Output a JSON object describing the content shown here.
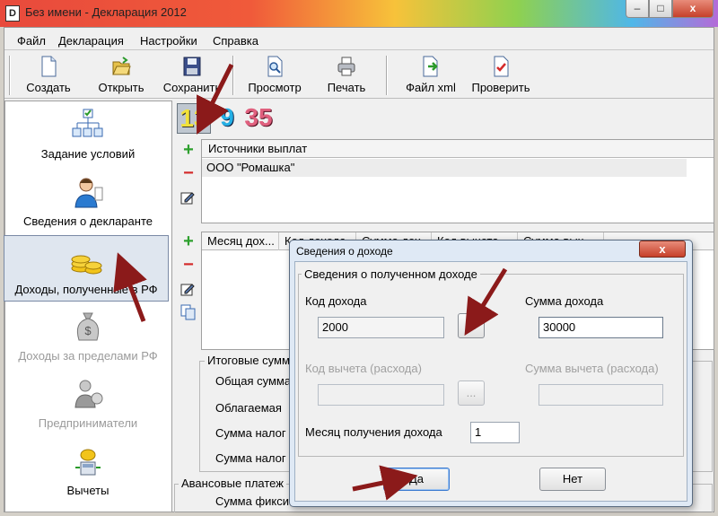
{
  "window": {
    "title": "Без имени - Декларация 2012",
    "app_icon": "document-icon"
  },
  "menu": [
    "Файл",
    "Декларация",
    "Настройки",
    "Справка"
  ],
  "toolbar": {
    "buttons": [
      {
        "label": "Создать",
        "icon": "new-document-icon"
      },
      {
        "label": "Открыть",
        "icon": "open-folder-icon"
      },
      {
        "label": "Сохранить",
        "icon": "floppy-save-icon"
      },
      {
        "label": "Просмотр",
        "icon": "preview-icon"
      },
      {
        "label": "Печать",
        "icon": "printer-icon"
      },
      {
        "label": "Файл xml",
        "icon": "xml-export-icon"
      },
      {
        "label": "Проверить",
        "icon": "check-document-icon"
      }
    ]
  },
  "sidebar": {
    "items": [
      {
        "label": "Задание условий",
        "icon": "conditions-tree-icon",
        "enabled": true
      },
      {
        "label": "Сведения о декларанте",
        "icon": "person-icon",
        "enabled": true
      },
      {
        "label": "Доходы, полученные в РФ",
        "icon": "coins-icon",
        "enabled": true,
        "selected": true
      },
      {
        "label": "Доходы за пределами РФ",
        "icon": "money-bag-icon",
        "enabled": false
      },
      {
        "label": "Предприниматели",
        "icon": "entrepreneur-icon",
        "enabled": false
      },
      {
        "label": "Вычеты",
        "icon": "deductions-icon",
        "enabled": true
      }
    ]
  },
  "rate_tabs": [
    "13",
    "9",
    "35"
  ],
  "sources": {
    "header": "Источники выплат",
    "rows": [
      "ООО \"Ромашка\""
    ]
  },
  "income_grid": {
    "columns": [
      "Месяц дох...",
      "Код дохода",
      "Сумма дох...",
      "Код вычета",
      "Сумма выч..."
    ]
  },
  "totals": {
    "group_title": "Итоговые сумм",
    "rows": [
      "Общая сумма",
      "Облагаемая",
      "Сумма налог",
      "Сумма налог"
    ]
  },
  "advance": {
    "group_title": "Авансовые платеж",
    "row": "Сумма фикси"
  },
  "dialog": {
    "title": "Сведения о доходе",
    "group_title": "Сведения о полученном доходе",
    "income_code_label": "Код дохода",
    "income_code_value": "2000",
    "lookup_button": "...",
    "income_amount_label": "Сумма дохода",
    "income_amount_value": "30000",
    "deduction_code_label": "Код вычета (расхода)",
    "deduction_lookup_button": "...",
    "deduction_amount_label": "Сумма вычета (расхода)",
    "month_label": "Месяц получения дохода",
    "month_value": "1",
    "ok_button": "Да",
    "cancel_button": "Нет",
    "close_glyph": "x"
  },
  "window_controls": {
    "minimize": "–",
    "maximize": "□",
    "close": "x"
  }
}
